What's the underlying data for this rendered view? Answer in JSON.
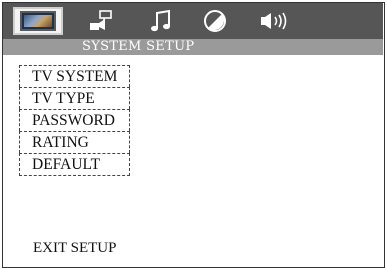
{
  "tabs": [
    {
      "icon": "tv-screen-icon",
      "selected": true
    },
    {
      "icon": "speaker-settings-icon",
      "selected": false
    },
    {
      "icon": "music-note-icon",
      "selected": false
    },
    {
      "icon": "contrast-circle-icon",
      "selected": false
    },
    {
      "icon": "volume-icon",
      "selected": false
    }
  ],
  "header": {
    "title": "SYSTEM SETUP"
  },
  "menu": {
    "items": [
      {
        "label": "TV SYSTEM"
      },
      {
        "label": "TV TYPE"
      },
      {
        "label": "PASSWORD"
      },
      {
        "label": "RATING"
      },
      {
        "label": "DEFAULT"
      }
    ]
  },
  "footer": {
    "exit_label": "EXIT SETUP"
  },
  "colors": {
    "tabbar_bg": "#565656",
    "subheader_bg": "#9a9a9a",
    "text": "#111111",
    "header_text": "#ffffff"
  }
}
